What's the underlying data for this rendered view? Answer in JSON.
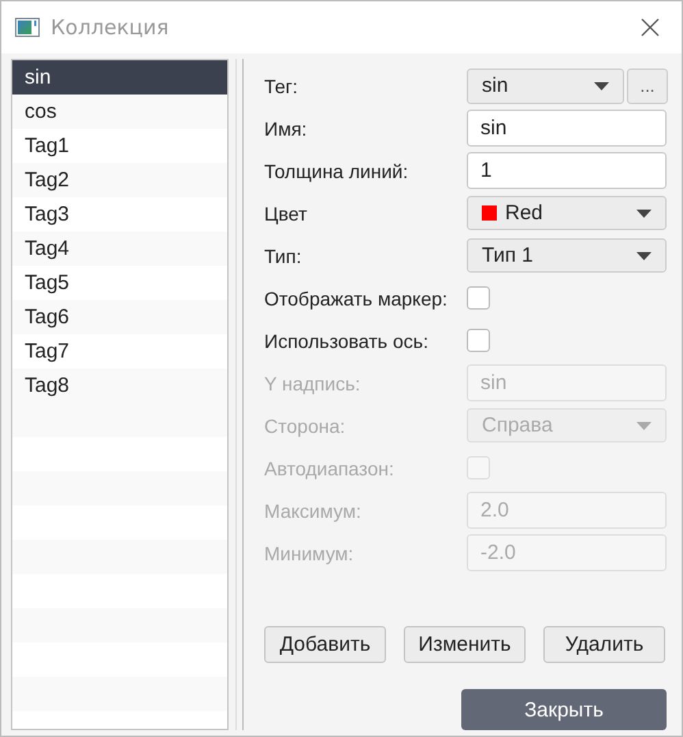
{
  "window": {
    "title": "Коллекция"
  },
  "list": {
    "items": [
      {
        "label": "sin",
        "selected": true
      },
      {
        "label": "cos",
        "selected": false
      },
      {
        "label": "Tag1",
        "selected": false
      },
      {
        "label": "Tag2",
        "selected": false
      },
      {
        "label": "Tag3",
        "selected": false
      },
      {
        "label": "Tag4",
        "selected": false
      },
      {
        "label": "Tag5",
        "selected": false
      },
      {
        "label": "Tag6",
        "selected": false
      },
      {
        "label": "Tag7",
        "selected": false
      },
      {
        "label": "Tag8",
        "selected": false
      }
    ]
  },
  "form": [
    {
      "kind": "combo",
      "label": "Тег:",
      "value": "sin",
      "disabled": false,
      "extra_button": "..."
    },
    {
      "kind": "text",
      "label": "Имя:",
      "value": "sin",
      "disabled": false
    },
    {
      "kind": "text",
      "label": "Толщина линий:",
      "value": "1",
      "disabled": false
    },
    {
      "kind": "color",
      "label": "Цвет",
      "value": "Red",
      "color": "#ff0000",
      "disabled": false
    },
    {
      "kind": "combo",
      "label": "Тип:",
      "value": "Тип 1",
      "disabled": false
    },
    {
      "kind": "checkbox",
      "label": "Отображать маркер:",
      "checked": false,
      "disabled": false
    },
    {
      "kind": "checkbox",
      "label": "Использовать ось:",
      "checked": false,
      "disabled": false
    },
    {
      "kind": "text",
      "label": "Y надпись:",
      "value": "sin",
      "disabled": true
    },
    {
      "kind": "combo",
      "label": "Сторона:",
      "value": "Справа",
      "disabled": true
    },
    {
      "kind": "checkbox",
      "label": "Автодиапазон:",
      "checked": false,
      "disabled": true
    },
    {
      "kind": "text",
      "label": "Максимум:",
      "value": "2.0",
      "disabled": true
    },
    {
      "kind": "text",
      "label": "Минимум:",
      "value": "-2.0",
      "disabled": true
    }
  ],
  "actions": [
    "Добавить",
    "Изменить",
    "Удалить"
  ],
  "close_button": "Закрыть"
}
